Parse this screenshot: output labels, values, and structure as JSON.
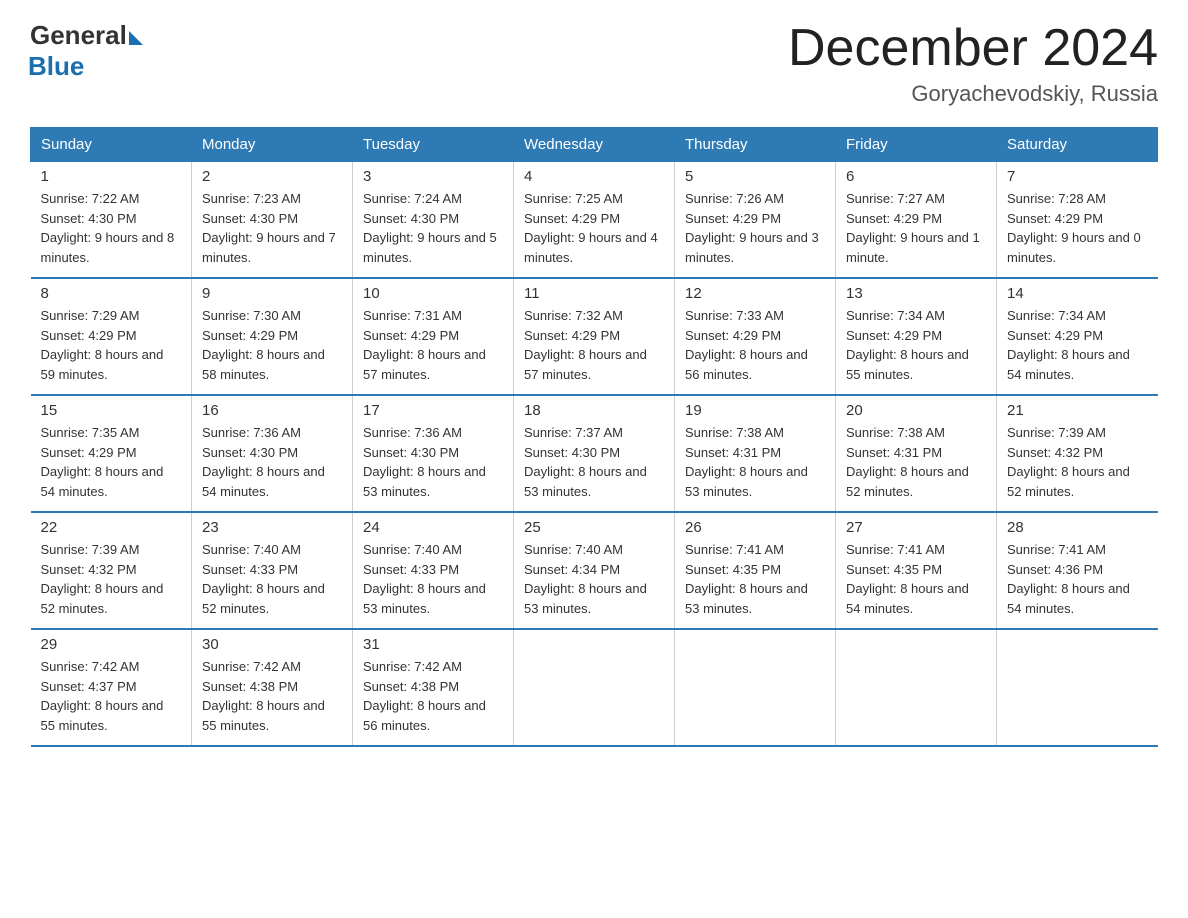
{
  "logo": {
    "general": "General",
    "blue": "Blue"
  },
  "title": "December 2024",
  "subtitle": "Goryachevodskiy, Russia",
  "weekdays": [
    "Sunday",
    "Monday",
    "Tuesday",
    "Wednesday",
    "Thursday",
    "Friday",
    "Saturday"
  ],
  "weeks": [
    [
      {
        "day": "1",
        "sunrise": "7:22 AM",
        "sunset": "4:30 PM",
        "daylight": "9 hours and 8 minutes."
      },
      {
        "day": "2",
        "sunrise": "7:23 AM",
        "sunset": "4:30 PM",
        "daylight": "9 hours and 7 minutes."
      },
      {
        "day": "3",
        "sunrise": "7:24 AM",
        "sunset": "4:30 PM",
        "daylight": "9 hours and 5 minutes."
      },
      {
        "day": "4",
        "sunrise": "7:25 AM",
        "sunset": "4:29 PM",
        "daylight": "9 hours and 4 minutes."
      },
      {
        "day": "5",
        "sunrise": "7:26 AM",
        "sunset": "4:29 PM",
        "daylight": "9 hours and 3 minutes."
      },
      {
        "day": "6",
        "sunrise": "7:27 AM",
        "sunset": "4:29 PM",
        "daylight": "9 hours and 1 minute."
      },
      {
        "day": "7",
        "sunrise": "7:28 AM",
        "sunset": "4:29 PM",
        "daylight": "9 hours and 0 minutes."
      }
    ],
    [
      {
        "day": "8",
        "sunrise": "7:29 AM",
        "sunset": "4:29 PM",
        "daylight": "8 hours and 59 minutes."
      },
      {
        "day": "9",
        "sunrise": "7:30 AM",
        "sunset": "4:29 PM",
        "daylight": "8 hours and 58 minutes."
      },
      {
        "day": "10",
        "sunrise": "7:31 AM",
        "sunset": "4:29 PM",
        "daylight": "8 hours and 57 minutes."
      },
      {
        "day": "11",
        "sunrise": "7:32 AM",
        "sunset": "4:29 PM",
        "daylight": "8 hours and 57 minutes."
      },
      {
        "day": "12",
        "sunrise": "7:33 AM",
        "sunset": "4:29 PM",
        "daylight": "8 hours and 56 minutes."
      },
      {
        "day": "13",
        "sunrise": "7:34 AM",
        "sunset": "4:29 PM",
        "daylight": "8 hours and 55 minutes."
      },
      {
        "day": "14",
        "sunrise": "7:34 AM",
        "sunset": "4:29 PM",
        "daylight": "8 hours and 54 minutes."
      }
    ],
    [
      {
        "day": "15",
        "sunrise": "7:35 AM",
        "sunset": "4:29 PM",
        "daylight": "8 hours and 54 minutes."
      },
      {
        "day": "16",
        "sunrise": "7:36 AM",
        "sunset": "4:30 PM",
        "daylight": "8 hours and 54 minutes."
      },
      {
        "day": "17",
        "sunrise": "7:36 AM",
        "sunset": "4:30 PM",
        "daylight": "8 hours and 53 minutes."
      },
      {
        "day": "18",
        "sunrise": "7:37 AM",
        "sunset": "4:30 PM",
        "daylight": "8 hours and 53 minutes."
      },
      {
        "day": "19",
        "sunrise": "7:38 AM",
        "sunset": "4:31 PM",
        "daylight": "8 hours and 53 minutes."
      },
      {
        "day": "20",
        "sunrise": "7:38 AM",
        "sunset": "4:31 PM",
        "daylight": "8 hours and 52 minutes."
      },
      {
        "day": "21",
        "sunrise": "7:39 AM",
        "sunset": "4:32 PM",
        "daylight": "8 hours and 52 minutes."
      }
    ],
    [
      {
        "day": "22",
        "sunrise": "7:39 AM",
        "sunset": "4:32 PM",
        "daylight": "8 hours and 52 minutes."
      },
      {
        "day": "23",
        "sunrise": "7:40 AM",
        "sunset": "4:33 PM",
        "daylight": "8 hours and 52 minutes."
      },
      {
        "day": "24",
        "sunrise": "7:40 AM",
        "sunset": "4:33 PM",
        "daylight": "8 hours and 53 minutes."
      },
      {
        "day": "25",
        "sunrise": "7:40 AM",
        "sunset": "4:34 PM",
        "daylight": "8 hours and 53 minutes."
      },
      {
        "day": "26",
        "sunrise": "7:41 AM",
        "sunset": "4:35 PM",
        "daylight": "8 hours and 53 minutes."
      },
      {
        "day": "27",
        "sunrise": "7:41 AM",
        "sunset": "4:35 PM",
        "daylight": "8 hours and 54 minutes."
      },
      {
        "day": "28",
        "sunrise": "7:41 AM",
        "sunset": "4:36 PM",
        "daylight": "8 hours and 54 minutes."
      }
    ],
    [
      {
        "day": "29",
        "sunrise": "7:42 AM",
        "sunset": "4:37 PM",
        "daylight": "8 hours and 55 minutes."
      },
      {
        "day": "30",
        "sunrise": "7:42 AM",
        "sunset": "4:38 PM",
        "daylight": "8 hours and 55 minutes."
      },
      {
        "day": "31",
        "sunrise": "7:42 AM",
        "sunset": "4:38 PM",
        "daylight": "8 hours and 56 minutes."
      },
      null,
      null,
      null,
      null
    ]
  ],
  "labels": {
    "sunrise": "Sunrise:",
    "sunset": "Sunset:",
    "daylight": "Daylight:"
  }
}
